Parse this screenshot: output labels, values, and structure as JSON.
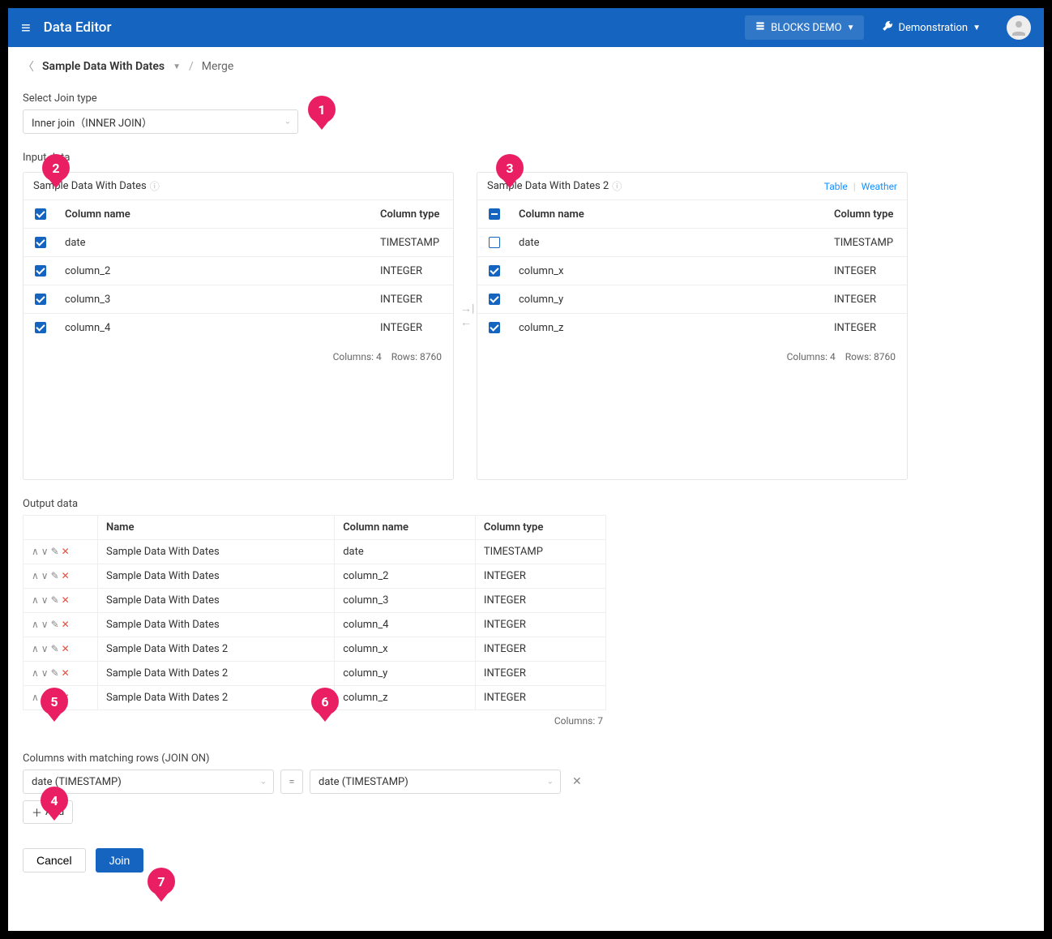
{
  "topbar": {
    "app_title": "Data Editor",
    "project_chip": "BLOCKS DEMO",
    "demo_chip": "Demonstration"
  },
  "breadcrumbs": {
    "dataset": "Sample Data With Dates",
    "page": "Merge"
  },
  "join_type": {
    "label": "Select Join type",
    "value": "Inner join（INNER JOIN）"
  },
  "input_data_label": "Input data",
  "left_panel": {
    "title": "Sample Data With Dates",
    "header_check": "checked",
    "col_header_name": "Column name",
    "col_header_type": "Column type",
    "rows": [
      {
        "checked": true,
        "name": "date",
        "type": "TIMESTAMP"
      },
      {
        "checked": true,
        "name": "column_2",
        "type": "INTEGER"
      },
      {
        "checked": true,
        "name": "column_3",
        "type": "INTEGER"
      },
      {
        "checked": true,
        "name": "column_4",
        "type": "INTEGER"
      }
    ],
    "foot_cols": "Columns: 4",
    "foot_rows": "Rows: 8760"
  },
  "right_panel": {
    "title": "Sample Data With Dates 2",
    "link_table": "Table",
    "link_weather": "Weather",
    "header_check": "indeterminate",
    "col_header_name": "Column name",
    "col_header_type": "Column type",
    "rows": [
      {
        "checked": false,
        "name": "date",
        "type": "TIMESTAMP"
      },
      {
        "checked": true,
        "name": "column_x",
        "type": "INTEGER"
      },
      {
        "checked": true,
        "name": "column_y",
        "type": "INTEGER"
      },
      {
        "checked": true,
        "name": "column_z",
        "type": "INTEGER"
      }
    ],
    "foot_cols": "Columns: 4",
    "foot_rows": "Rows: 8760"
  },
  "output": {
    "label": "Output data",
    "h_name": "Name",
    "h_colname": "Column name",
    "h_coltype": "Column type",
    "rows": [
      {
        "name": "Sample Data With Dates",
        "col": "date",
        "type": "TIMESTAMP"
      },
      {
        "name": "Sample Data With Dates",
        "col": "column_2",
        "type": "INTEGER"
      },
      {
        "name": "Sample Data With Dates",
        "col": "column_3",
        "type": "INTEGER"
      },
      {
        "name": "Sample Data With Dates",
        "col": "column_4",
        "type": "INTEGER"
      },
      {
        "name": "Sample Data With Dates 2",
        "col": "column_x",
        "type": "INTEGER"
      },
      {
        "name": "Sample Data With Dates 2",
        "col": "column_y",
        "type": "INTEGER"
      },
      {
        "name": "Sample Data With Dates 2",
        "col": "column_z",
        "type": "INTEGER"
      }
    ],
    "foot": "Columns: 7"
  },
  "join_on": {
    "label": "Columns with matching rows (JOIN ON)",
    "left_value": "date (TIMESTAMP)",
    "right_value": "date (TIMESTAMP)",
    "eq": "=",
    "add_label": "Add"
  },
  "actions": {
    "cancel": "Cancel",
    "join": "Join"
  },
  "markers": {
    "m1": "1",
    "m2": "2",
    "m3": "3",
    "m4": "4",
    "m5": "5",
    "m6": "6",
    "m7": "7"
  }
}
